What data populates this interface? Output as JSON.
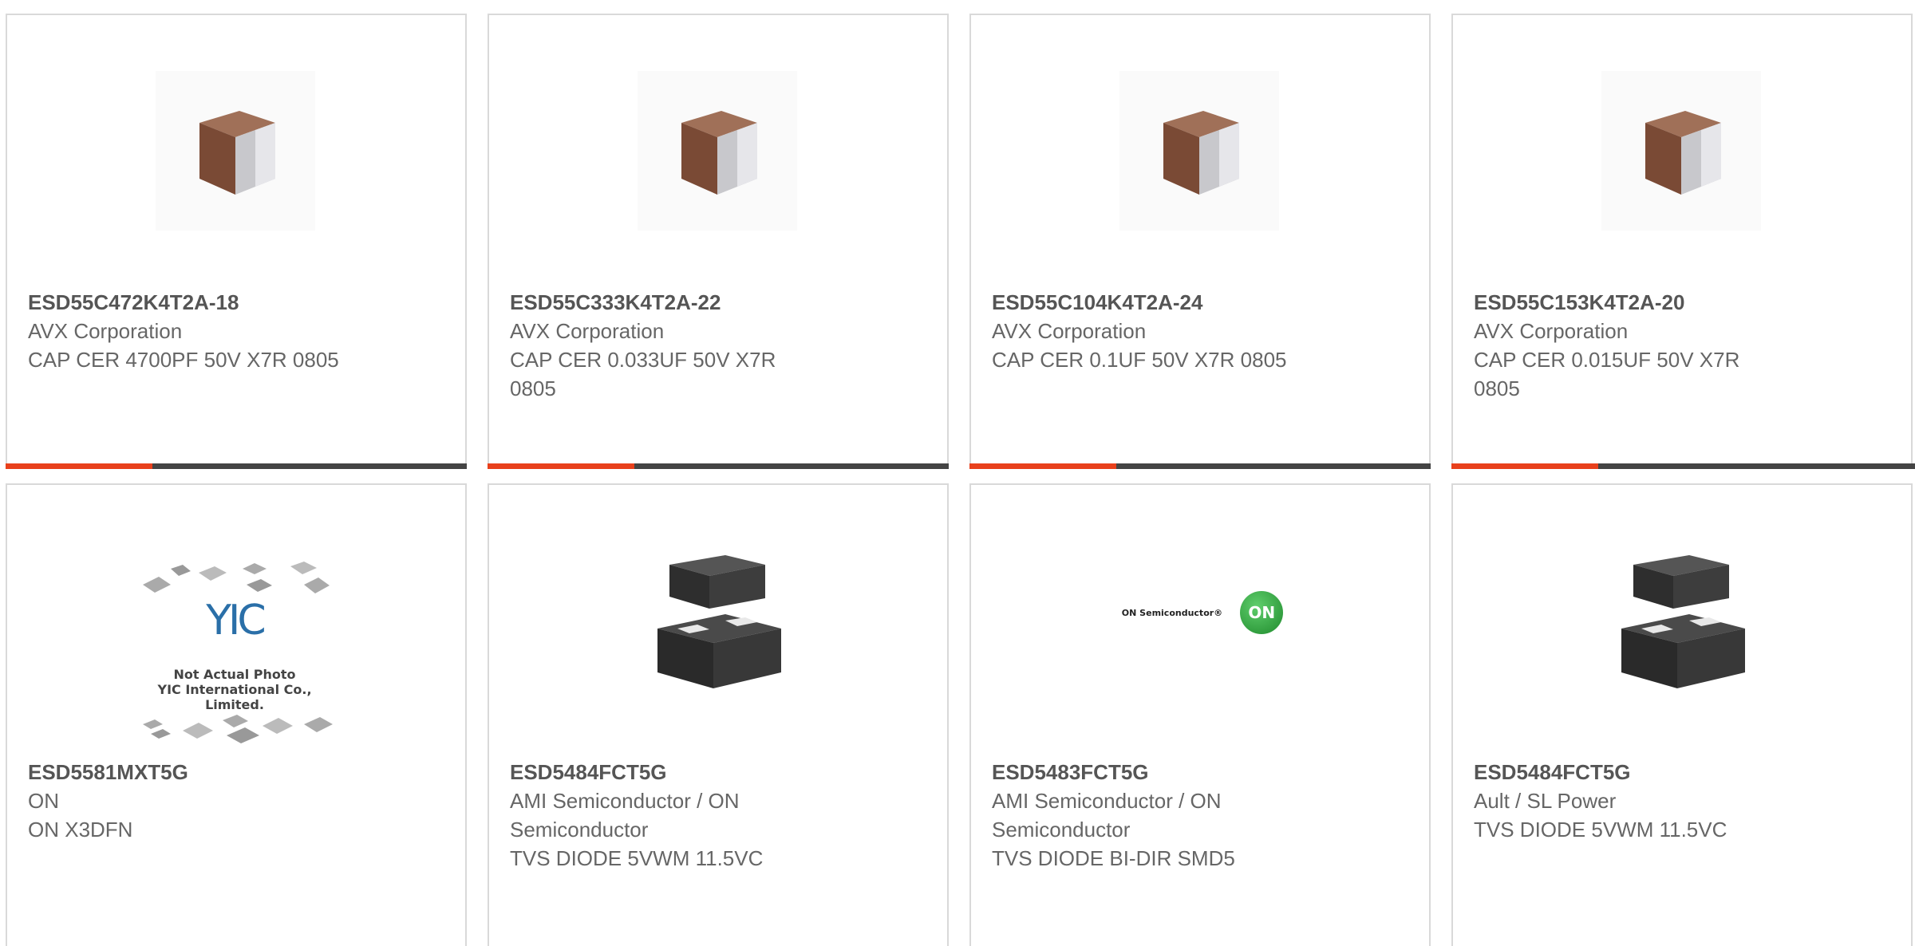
{
  "colors": {
    "accent": "#e8401c",
    "bar": "#444444",
    "border": "#d9d9d9",
    "text_bold": "#555555",
    "text": "#666666"
  },
  "products": [
    {
      "part": "ESD55C472K4T2A-18",
      "manufacturer": "AVX Corporation",
      "description": "CAP CER 4700PF 50V X7R 0805",
      "image": "capacitor-chip-image"
    },
    {
      "part": "ESD55C333K4T2A-22",
      "manufacturer": "AVX Corporation",
      "description": "CAP CER 0.033UF 50V X7R 0805",
      "image": "capacitor-chip-image"
    },
    {
      "part": "ESD55C104K4T2A-24",
      "manufacturer": "AVX Corporation",
      "description": "CAP CER 0.1UF 50V X7R 0805",
      "image": "capacitor-chip-image"
    },
    {
      "part": "ESD55C153K4T2A-20",
      "manufacturer": "AVX Corporation",
      "description": "CAP CER 0.015UF 50V X7R 0805",
      "image": "capacitor-chip-image"
    },
    {
      "part": "ESD5581MXT5G",
      "manufacturer": "ON",
      "description": "ON X3DFN",
      "image": "not-actual-photo-placeholder",
      "placeholder_line1": "Not Actual Photo",
      "placeholder_line2": "YIC International Co., Limited.",
      "placeholder_logo": "YIC"
    },
    {
      "part": "ESD5484FCT5G",
      "manufacturer": "AMI Semiconductor / ON Semiconductor",
      "description": "TVS DIODE 5VWM 11.5VC",
      "image": "diode-package-image"
    },
    {
      "part": "ESD5483FCT5G",
      "manufacturer": "AMI Semiconductor / ON Semiconductor",
      "description": "TVS DIODE BI-DIR SMD5",
      "image": "on-semiconductor-logo",
      "logo_text": "ON Semiconductor®",
      "logo_badge": "ON"
    },
    {
      "part": "ESD5484FCT5G",
      "manufacturer": "Ault / SL Power",
      "description": "TVS DIODE 5VWM 11.5VC",
      "image": "diode-package-image"
    }
  ]
}
